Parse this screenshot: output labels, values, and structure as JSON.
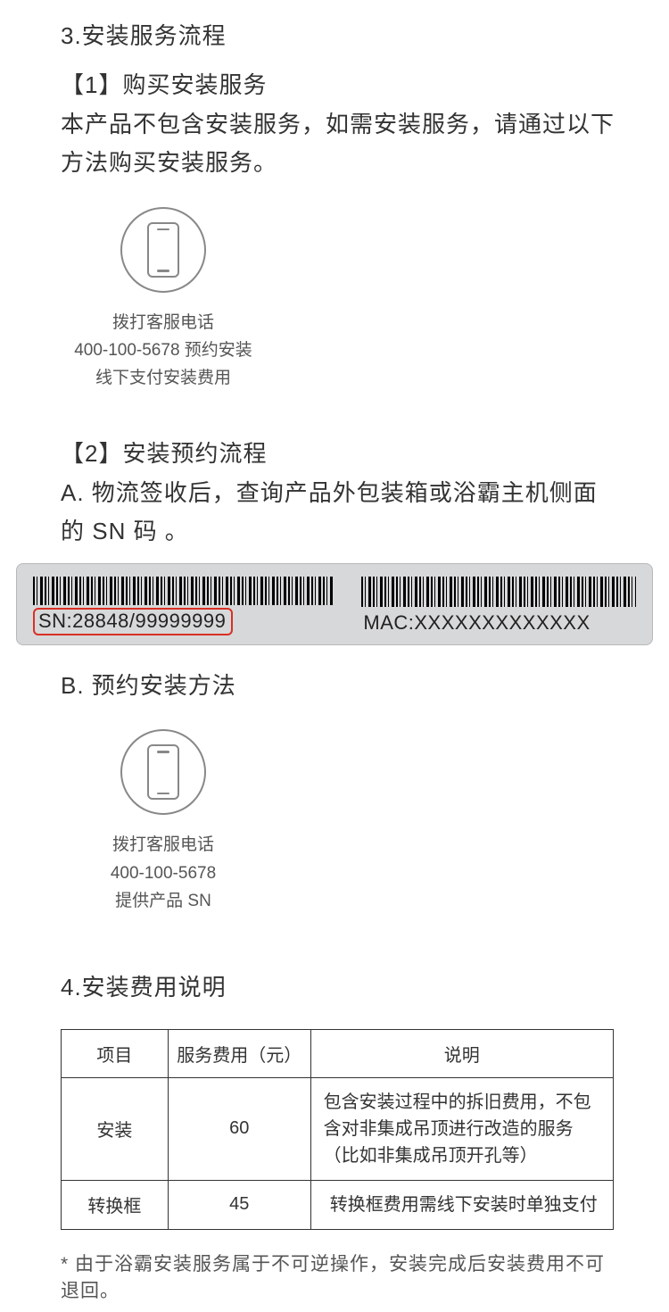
{
  "section3": {
    "title": "3.安装服务流程",
    "step1": {
      "heading": "【1】购买安装服务",
      "body": "本产品不包含安装服务，如需安装服务，请通过以下方法购买安装服务。",
      "caption_line1": "拨打客服电话",
      "caption_line2": "400-100-5678 预约安装",
      "caption_line3": "线下支付安装费用"
    },
    "step2": {
      "heading": "【2】安装预约流程",
      "body_a": "A. 物流签收后，查询产品外包装箱或浴霸主机侧面的 SN 码 。",
      "sn_text": "SN:28848/99999999",
      "mac_text": "MAC:XXXXXXXXXXXXX",
      "body_b": "B. 预约安装方法",
      "caption_line1": "拨打客服电话",
      "caption_line2": "400-100-5678",
      "caption_line3": "提供产品 SN"
    }
  },
  "section4": {
    "title": "4.安装费用说明",
    "headers": {
      "c1": "项目",
      "c2": "服务费用（元）",
      "c3": "说明"
    },
    "rows": [
      {
        "item": "安装",
        "fee": "60",
        "desc": "包含安装过程中的拆旧费用，不包含对非集成吊顶进行改造的服务（比如非集成吊顶开孔等）"
      },
      {
        "item": "转换框",
        "fee": "45",
        "desc": "转换框费用需线下安装时单独支付"
      }
    ],
    "footnote": "* 由于浴霸安装服务属于不可逆操作，安装完成后安装费用不可退回。"
  }
}
